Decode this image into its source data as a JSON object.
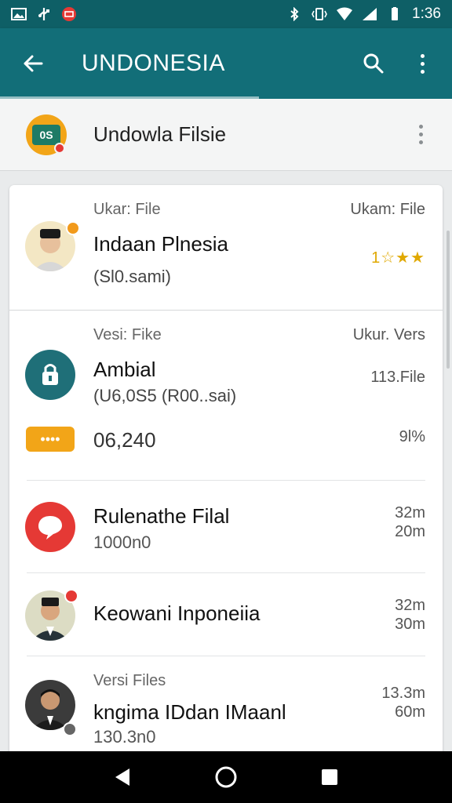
{
  "status": {
    "time": "1:36",
    "left_icons": [
      "image-icon",
      "usb-icon",
      "notification-icon"
    ],
    "right_icons": [
      "bluetooth-icon",
      "vibrate-icon",
      "wifi-icon",
      "signal-icon",
      "battery-icon"
    ]
  },
  "appbar": {
    "title": "UNDONESIA",
    "back_icon": "arrow-back-icon",
    "search_icon": "search-icon",
    "menu_icon": "more-vert-icon"
  },
  "header": {
    "logo_text": "0S",
    "title": "Undowla Filsie"
  },
  "items": [
    {
      "label_left": "Ukar: File",
      "label_right": "Ukam: File",
      "title": "Indaan Plnesia",
      "subtitle": "(Sl0.sami)",
      "rating_text": "1☆★★"
    },
    {
      "label_left": "Vesi: Fike",
      "label_right": "Ukur. Vers",
      "title": "Ambial",
      "subtitle": "(U6,0S5 (R00..sai)",
      "right_value": "113.File",
      "amount": "06,240",
      "amount_right": "9l%",
      "chip_text": "••••"
    },
    {
      "title": "Rulenathe Filal",
      "subtitle": "1000n0",
      "right_top": "32m",
      "right_bottom": "20m"
    },
    {
      "title": "Keowani Inponeiia",
      "right_top": "32m",
      "right_bottom": "30m"
    },
    {
      "label_left": "Versi Files",
      "title": "kngima IDdan IMaanl",
      "subtitle": "130.3n0",
      "right_top": "13.3m",
      "right_bottom": "60m"
    }
  ],
  "navbar": {
    "back": "nav-back-icon",
    "home": "nav-home-icon",
    "recents": "nav-recents-icon"
  },
  "colors": {
    "primary": "#126e78",
    "status_bar": "#0e5f66",
    "accent_orange": "#f2a518",
    "accent_red": "#e53935",
    "accent_teal": "#1f6f78"
  }
}
